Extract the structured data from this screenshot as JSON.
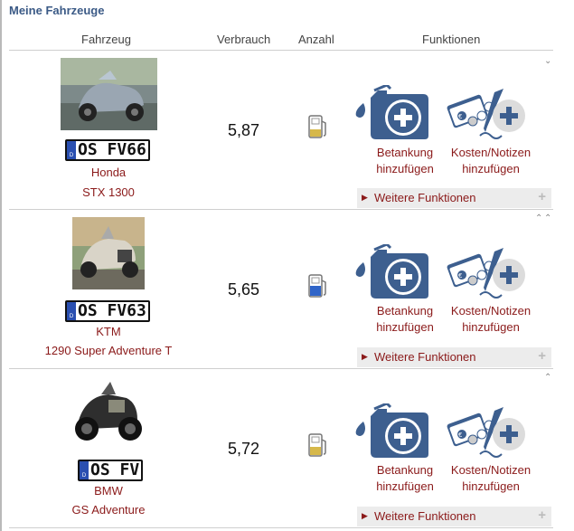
{
  "section_title": "Meine Fahrzeuge",
  "table_header": {
    "vehicle": "Fahrzeug",
    "consumption": "Verbrauch",
    "count": "Anzahl",
    "functions": "Funktionen"
  },
  "vehicles": [
    {
      "plate": "OS FV66",
      "make": "Honda",
      "model": "STX 1300",
      "consumption": "5,87",
      "gauge_level": 0.2,
      "actions": {
        "refuel": "Betankung hinzufügen",
        "costs": "Kosten/Notizen hinzufügen"
      },
      "more_functions": "Weitere Funktionen"
    },
    {
      "plate": "OS FV63",
      "make": "KTM",
      "model": "1290 Super Adventure T",
      "consumption": "5,65",
      "gauge_level": 0.5,
      "actions": {
        "refuel": "Betankung hinzufügen",
        "costs": "Kosten/Notizen hinzufügen"
      },
      "more_functions": "Weitere Funktionen"
    },
    {
      "plate": "OS FV",
      "make": "BMW",
      "model": "GS Adventure",
      "consumption": "5,72",
      "gauge_level": 0.3,
      "actions": {
        "refuel": "Betankung hinzufügen",
        "costs": "Kosten/Notizen hinzufügen"
      },
      "more_functions": "Weitere Funktionen"
    }
  ],
  "ui": {
    "more_functions_plus": "+",
    "plate_eu_letter": "D",
    "refuel_line1": "Betankung",
    "refuel_line2": "hinzufügen",
    "costs_line1": "Kosten/Notizen",
    "costs_line2": "hinzufügen"
  },
  "colors": {
    "accent": "#8b1a1a",
    "title": "#3b5a86",
    "icon": "#3d5f8f",
    "gauge_yellow": "#d6b84a",
    "gauge_blue": "#2f64c8"
  }
}
